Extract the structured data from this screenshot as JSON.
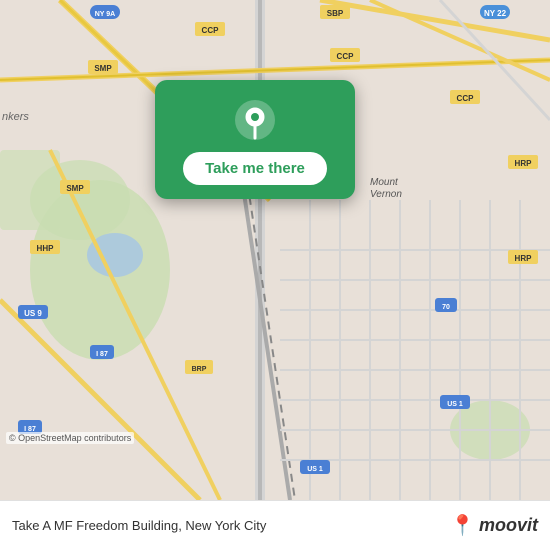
{
  "map": {
    "alt": "Map showing Take A MF Freedom Building, New York City",
    "osm_attribution": "© OpenStreetMap contributors"
  },
  "popup": {
    "take_me_there_label": "Take me there"
  },
  "bottom_bar": {
    "location_text": "Take A MF Freedom Building, New York City",
    "logo_name": "moovit"
  }
}
